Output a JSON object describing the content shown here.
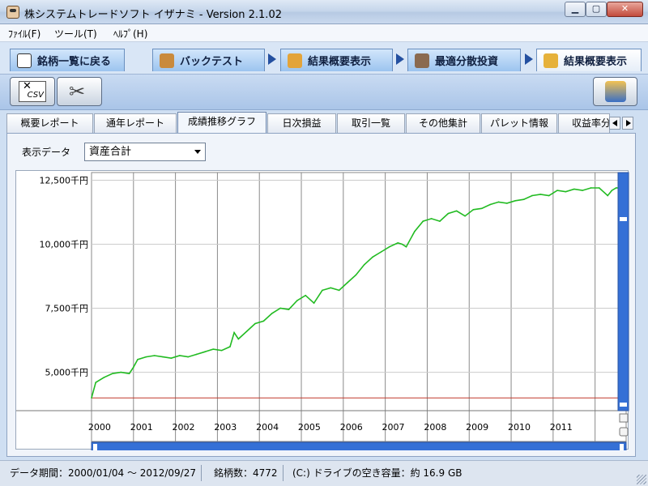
{
  "window": {
    "title": "株システムトレードソフト イザナミ - Version 2.1.02",
    "min_label": "▁",
    "max_label": "▢",
    "close_label": "✕"
  },
  "menu": [
    "ﾌｧｲﾙ(F)",
    "ツール(T)",
    "ﾍﾙﾌﾟ(H)"
  ],
  "nav_tabs": [
    {
      "label": "銘柄一覧に戻る",
      "icon": "eye-icon"
    },
    {
      "label": "バックテスト",
      "icon": "bag-icon"
    },
    {
      "label": "結果概要表示",
      "icon": "coins-icon"
    },
    {
      "label": "最適分散投資",
      "icon": "calculator-icon"
    },
    {
      "label": "結果概要表示",
      "icon": "chart-icon"
    }
  ],
  "toolbar": {
    "csv_icon": "csv-export-icon",
    "csv_label": "CSV",
    "tools_icon": "tools-icon",
    "money_icon": "money-icon"
  },
  "sub_tabs": [
    "概要レポート",
    "通年レポート",
    "成績推移グラフ",
    "日次損益",
    "取引一覧",
    "その他集計",
    "パレット情報",
    "収益率分"
  ],
  "active_sub_tab": 2,
  "display": {
    "label": "表示データ",
    "selected": "資産合計"
  },
  "chart_data": {
    "type": "line",
    "y_ticks": [
      {
        "value": 5000,
        "label": "5,000千円"
      },
      {
        "value": 7500,
        "label": "7,500千円"
      },
      {
        "value": 10000,
        "label": "10,000千円"
      },
      {
        "value": 12500,
        "label": "12,500千円"
      }
    ],
    "ylim": [
      3500,
      12800
    ],
    "x_range": [
      2000.0,
      2012.74
    ],
    "x_labels": [
      "2000",
      "2001",
      "2002",
      "2003",
      "2004",
      "2005",
      "2006",
      "2007",
      "2008",
      "2009",
      "2010",
      "2011"
    ],
    "baseline": {
      "value": 4000,
      "color": "#c0392b"
    },
    "series": [
      {
        "color": "#22bb22",
        "x": [
          2000.0,
          2000.1,
          2000.3,
          2000.5,
          2000.7,
          2000.9,
          2001.0,
          2001.1,
          2001.3,
          2001.5,
          2001.7,
          2001.9,
          2002.1,
          2002.3,
          2002.5,
          2002.7,
          2002.9,
          2003.1,
          2003.3,
          2003.4,
          2003.5,
          2003.7,
          2003.9,
          2004.1,
          2004.3,
          2004.5,
          2004.7,
          2004.9,
          2005.1,
          2005.3,
          2005.5,
          2005.7,
          2005.9,
          2006.1,
          2006.3,
          2006.5,
          2006.7,
          2006.9,
          2007.1,
          2007.3,
          2007.4,
          2007.5,
          2007.7,
          2007.9,
          2008.1,
          2008.3,
          2008.5,
          2008.7,
          2008.9,
          2009.1,
          2009.3,
          2009.5,
          2009.7,
          2009.9,
          2010.1,
          2010.3,
          2010.5,
          2010.7,
          2010.9,
          2011.1,
          2011.3,
          2011.5,
          2011.7,
          2011.9,
          2012.1,
          2012.3,
          2012.4,
          2012.5,
          2012.74
        ],
        "values": [
          4000,
          4600,
          4800,
          4950,
          5000,
          4950,
          5200,
          5500,
          5600,
          5650,
          5600,
          5550,
          5650,
          5600,
          5700,
          5800,
          5900,
          5850,
          6000,
          6550,
          6300,
          6600,
          6900,
          7000,
          7300,
          7500,
          7450,
          7800,
          8000,
          7700,
          8200,
          8300,
          8200,
          8500,
          8800,
          9200,
          9500,
          9700,
          9900,
          10050,
          10000,
          9900,
          10500,
          10900,
          11000,
          10900,
          11200,
          11300,
          11100,
          11350,
          11400,
          11550,
          11650,
          11600,
          11700,
          11750,
          11900,
          11950,
          11900,
          12100,
          12050,
          12150,
          12100,
          12200,
          12200,
          11900,
          12100,
          12200,
          12200
        ]
      }
    ],
    "grid": true
  },
  "status": {
    "period": "データ期間：2000/01/04 〜 2012/09/27",
    "count": "銘柄数：4772",
    "disk": "(C:) ドライブの空き容量：約 16.9 GB"
  }
}
